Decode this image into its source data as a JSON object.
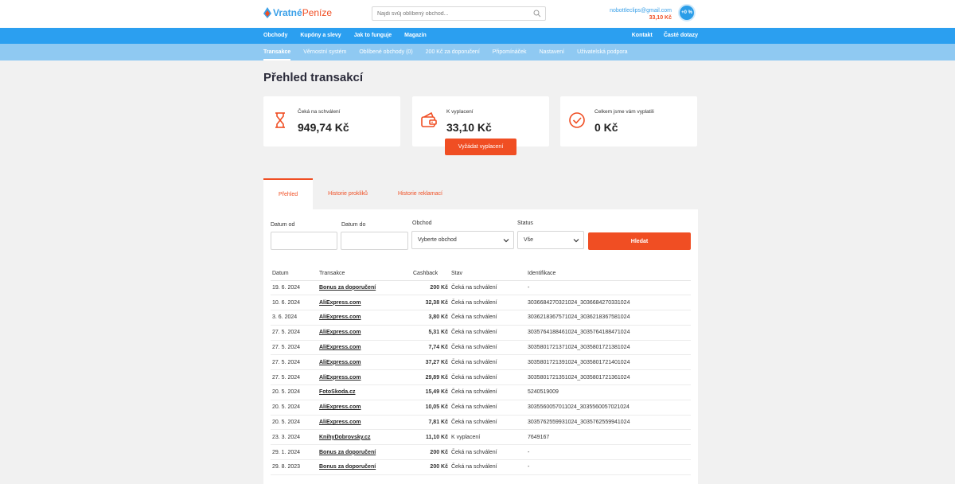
{
  "header": {
    "logo_part1": "Vratné",
    "logo_part2": "Peníze",
    "search_placeholder": "Najdi svůj oblíbený obchod...",
    "account_email": "nobottleclips@gmail.com",
    "account_balance": "33,10 Kč",
    "badge": "+0 %"
  },
  "nav_main": {
    "left": [
      "Obchody",
      "Kupóny a slevy",
      "Jak to funguje",
      "Magazín"
    ],
    "right": [
      "Kontakt",
      "Časté dotazy"
    ]
  },
  "nav_sub": {
    "items": [
      "Transakce",
      "Věrnostní systém",
      "Oblíbené obchody (0)",
      "200 Kč za doporučení",
      "Připomínáček",
      "Nastavení",
      "Uživatelská podpora"
    ],
    "active_index": 0
  },
  "page_title": "Přehled transakcí",
  "cards": [
    {
      "label": "Čeká na schválení",
      "value": "949,74 Kč",
      "icon": "hourglass-icon"
    },
    {
      "label": "K vyplacení",
      "value": "33,10 Kč",
      "icon": "wallet-icon"
    },
    {
      "label": "Celkem jsme vám vyplatili",
      "value": "0 Kč",
      "icon": "check-circle-icon"
    }
  ],
  "payout_button": "Vyžádat vyplacení",
  "tabs": [
    "Přehled",
    "Historie prokliků",
    "Historie reklamací"
  ],
  "filters": {
    "date_from_label": "Datum od",
    "date_from_value": "",
    "date_to_label": "Datum do",
    "date_to_value": "",
    "shop_label": "Obchod",
    "shop_value": "Vyberte obchod",
    "status_label": "Status",
    "status_value": "Vše",
    "search_button": "Hledat"
  },
  "table": {
    "headers": [
      "Datum",
      "Transakce",
      "Cashback",
      "Stav",
      "Identifikace"
    ],
    "rows": [
      {
        "date": "19. 6. 2024",
        "tx": "Bonus za doporučení",
        "cashback": "200 Kč",
        "status": "Čeká na schválení",
        "status_type": "wait",
        "id": "-"
      },
      {
        "date": "10. 6. 2024",
        "tx": "AliExpress.com",
        "cashback": "32,38 Kč",
        "status": "Čeká na schválení",
        "status_type": "wait",
        "id": "3036684270321024_3036684270331024"
      },
      {
        "date": "3. 6. 2024",
        "tx": "AliExpress.com",
        "cashback": "3,80 Kč",
        "status": "Čeká na schválení",
        "status_type": "wait",
        "id": "3036218367571024_3036218367581024"
      },
      {
        "date": "27. 5. 2024",
        "tx": "AliExpress.com",
        "cashback": "5,31 Kč",
        "status": "Čeká na schválení",
        "status_type": "wait",
        "id": "3035764188461024_3035764188471024"
      },
      {
        "date": "27. 5. 2024",
        "tx": "AliExpress.com",
        "cashback": "7,74 Kč",
        "status": "Čeká na schválení",
        "status_type": "wait",
        "id": "3035801721371024_3035801721381024"
      },
      {
        "date": "27. 5. 2024",
        "tx": "AliExpress.com",
        "cashback": "37,27 Kč",
        "status": "Čeká na schválení",
        "status_type": "wait",
        "id": "3035801721391024_3035801721401024"
      },
      {
        "date": "27. 5. 2024",
        "tx": "AliExpress.com",
        "cashback": "29,89 Kč",
        "status": "Čeká na schválení",
        "status_type": "wait",
        "id": "3035801721351024_3035801721361024"
      },
      {
        "date": "20. 5. 2024",
        "tx": "FotoSkoda.cz",
        "cashback": "15,49 Kč",
        "status": "Čeká na schválení",
        "status_type": "wait",
        "id": "5240519009"
      },
      {
        "date": "20. 5. 2024",
        "tx": "AliExpress.com",
        "cashback": "10,05 Kč",
        "status": "Čeká na schválení",
        "status_type": "wait",
        "id": "3035560057011024_3035560057021024"
      },
      {
        "date": "20. 5. 2024",
        "tx": "AliExpress.com",
        "cashback": "7,81 Kč",
        "status": "Čeká na schválení",
        "status_type": "wait",
        "id": "3035762559931024_3035762559941024"
      },
      {
        "date": "23. 3. 2024",
        "tx": "KnihyDobrovsky.cz",
        "cashback": "11,10 Kč",
        "status": "K vyplacení",
        "status_type": "pay",
        "id": "7649167"
      },
      {
        "date": "29. 1. 2024",
        "tx": "Bonus za doporučení",
        "cashback": "200 Kč",
        "status": "Čeká na schválení",
        "status_type": "wait",
        "id": "-"
      },
      {
        "date": "29. 8. 2023",
        "tx": "Bonus za doporučení",
        "cashback": "200 Kč",
        "status": "Čeká na schválení",
        "status_type": "wait",
        "id": "-"
      }
    ]
  },
  "colors": {
    "primary_blue": "#2b9ff0",
    "accent_red": "#f04e23",
    "status_wait": "#3aa0e8",
    "status_pay": "#3bbf4b"
  }
}
